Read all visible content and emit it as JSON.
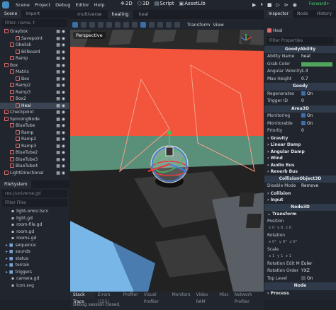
{
  "menubar": {
    "items": [
      "Scene",
      "Project",
      "Debug",
      "Editor",
      "Help"
    ],
    "modes": [
      "2D",
      "3D",
      "Script",
      "AssetLib"
    ],
    "renderer": "Forward+"
  },
  "scene_dock": {
    "tabs": [
      "Scene",
      "Import"
    ],
    "filter_placeholder": "Filter: name, t",
    "nodes": [
      {
        "label": "Graybox",
        "indent": 0
      },
      {
        "label": "Savepoint",
        "indent": 2
      },
      {
        "label": "Obelisk",
        "indent": 1
      },
      {
        "label": "Billboard",
        "indent": 2
      },
      {
        "label": "Ramp",
        "indent": 1
      },
      {
        "label": "Box",
        "indent": 0
      },
      {
        "label": "Matrix",
        "indent": 1
      },
      {
        "label": "Box",
        "indent": 2
      },
      {
        "label": "Ramp2",
        "indent": 1
      },
      {
        "label": "Ramp3",
        "indent": 1
      },
      {
        "label": "Box2",
        "indent": 1
      },
      {
        "label": "Heal",
        "indent": 2,
        "selected": true
      },
      {
        "label": "Checkpoint",
        "indent": 0
      },
      {
        "label": "SpinningNode",
        "indent": 0
      },
      {
        "label": "BlueTube",
        "indent": 1
      },
      {
        "label": "Ramp",
        "indent": 2
      },
      {
        "label": "Ramp2",
        "indent": 2
      },
      {
        "label": "Ramp3",
        "indent": 2
      },
      {
        "label": "BlueTube2",
        "indent": 1
      },
      {
        "label": "BlueTube3",
        "indent": 1
      },
      {
        "label": "BlueTube4",
        "indent": 1
      },
      {
        "label": "LightDirectional",
        "indent": 0
      }
    ]
  },
  "filesystem": {
    "title": "FileSystem",
    "path": "res://universe.gd",
    "filter_placeholder": "Filter Files",
    "items": [
      {
        "label": "light-omni.tscn",
        "type": "file"
      },
      {
        "label": "light.gd",
        "type": "file"
      },
      {
        "label": "room-file.gd",
        "type": "file"
      },
      {
        "label": "room.gd",
        "type": "file"
      },
      {
        "label": "rooms.gd",
        "type": "file"
      },
      {
        "label": "sequence",
        "type": "folder"
      },
      {
        "label": "sounds",
        "type": "folder"
      },
      {
        "label": "status",
        "type": "folder"
      },
      {
        "label": "terrain",
        "type": "folder"
      },
      {
        "label": "triggers",
        "type": "folder"
      },
      {
        "label": "camera.gd",
        "type": "file"
      },
      {
        "label": "icon.svg",
        "type": "file"
      }
    ]
  },
  "viewport": {
    "tabs": [
      "multiverse",
      "healing",
      "heal"
    ],
    "active_tab": "healing",
    "menus": [
      "Transform",
      "View"
    ],
    "perspective_label": "Perspective"
  },
  "bottom_panel": {
    "tabs": [
      "Stack Trace",
      "Errors (155)",
      "Profiler",
      "Visual Profiler",
      "Monitors",
      "Video RAM",
      "Misc",
      "Network Profiler"
    ],
    "status": "Debug session closed."
  },
  "inspector": {
    "tabs": [
      "Inspector",
      "Node",
      "History"
    ],
    "node_name": "Heal",
    "filter_placeholder": "Filter Properties",
    "goody_ability": {
      "section": "GoodyAbility",
      "ability_name_label": "Ability Name",
      "ability_name": "heal",
      "grab_color_label": "Grab Color",
      "grab_color": "#4ea55b",
      "angular_velocity_label": "Angular Velocity",
      "angular_velocity": "1.3",
      "max_height_label": "Max Height",
      "max_height": "0.7"
    },
    "goody": {
      "section": "Goody",
      "regenerates_label": "Regenerates",
      "regenerates": "On",
      "trigger_id_label": "Trigger ID",
      "trigger_id": "0"
    },
    "area3d": {
      "section": "Area3D",
      "monitoring_label": "Monitoring",
      "monitoring": "On",
      "monitorable_label": "Monitorable",
      "monitorable": "On",
      "priority_label": "Priority",
      "priority": "0",
      "categories": [
        "Gravity",
        "Linear Damp",
        "Angular Damp",
        "Wind",
        "Audio Bus",
        "Reverb Bus"
      ]
    },
    "collision_object": {
      "section": "CollisionObject3D",
      "disable_mode_label": "Disable Mode",
      "disable_mode": "Remove",
      "categories": [
        "Collision",
        "Input"
      ]
    },
    "node3d": {
      "section": "Node3D",
      "transform_label": "Transform",
      "position_label": "Position",
      "rotation_label": "Rotation",
      "scale_label": "Scale",
      "values": [
        "0",
        "0",
        "0",
        "0",
        "0",
        "0",
        "1",
        "1",
        "1"
      ],
      "rotation_edit_mode_label": "Rotation Edit M",
      "rotation_edit_mode": "Euler",
      "rotation_order_label": "Rotation Order",
      "rotation_order": "YXZ",
      "top_level_label": "Top Level",
      "top_level": "On"
    },
    "node": {
      "section": "Node",
      "process_label": "Process"
    }
  }
}
